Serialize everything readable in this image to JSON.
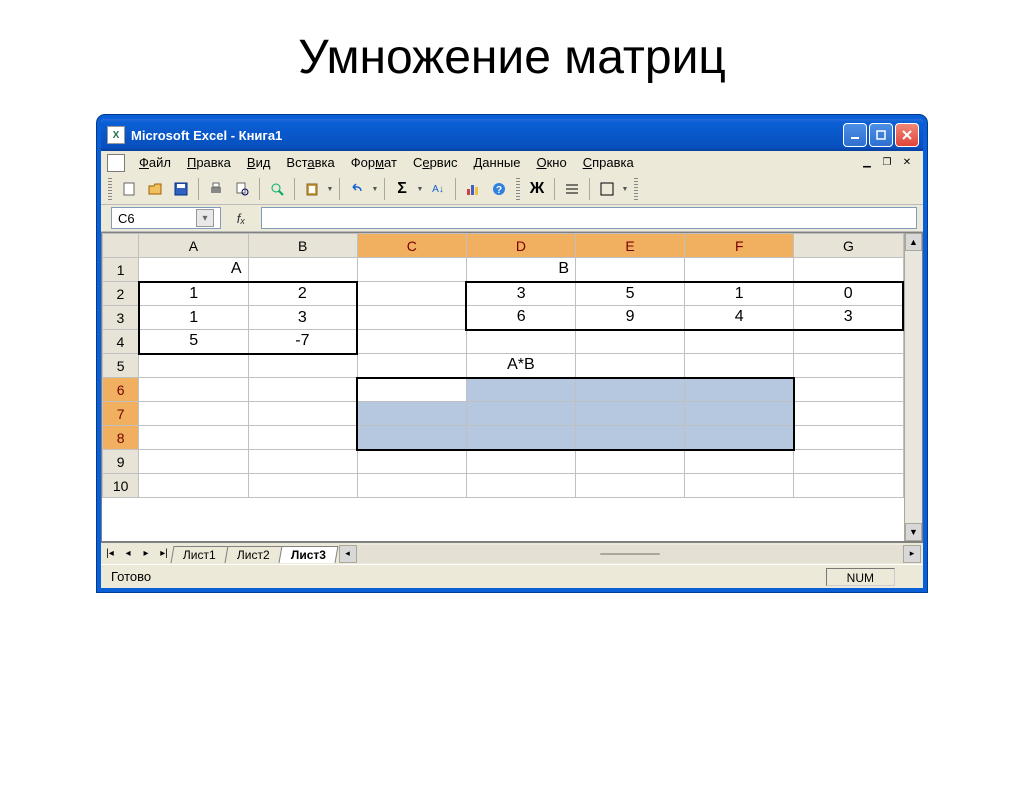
{
  "page_heading": "Умножение матриц",
  "window": {
    "title": "Microsoft Excel - Книга1"
  },
  "menus": [
    "Файл",
    "Правка",
    "Вид",
    "Вставка",
    "Формат",
    "Сервис",
    "Данные",
    "Окно",
    "Справка"
  ],
  "namebox": "C6",
  "columns": [
    "A",
    "B",
    "C",
    "D",
    "E",
    "F",
    "G"
  ],
  "selected_columns": [
    "C",
    "D",
    "E",
    "F"
  ],
  "selected_rows": [
    6,
    7,
    8
  ],
  "labels": {
    "matrixA": "A",
    "matrixB": "B",
    "result": "A*B"
  },
  "matrixA": [
    [
      1,
      2
    ],
    [
      1,
      3
    ],
    [
      5,
      -7
    ]
  ],
  "matrixB": [
    [
      3,
      5,
      1,
      0
    ],
    [
      6,
      9,
      4,
      3
    ]
  ],
  "sheets": [
    "Лист1",
    "Лист2",
    "Лист3"
  ],
  "active_sheet": "Лист3",
  "status": "Готово",
  "indicator": "NUM",
  "chart_data": {
    "type": "table",
    "title": "Умножение матриц",
    "matrices": {
      "A": {
        "rows": 3,
        "cols": 2,
        "data": [
          [
            1,
            2
          ],
          [
            1,
            3
          ],
          [
            5,
            -7
          ]
        ]
      },
      "B": {
        "rows": 2,
        "cols": 4,
        "data": [
          [
            3,
            5,
            1,
            0
          ],
          [
            6,
            9,
            4,
            3
          ]
        ]
      },
      "result_range": "C6:F8",
      "result_label": "A*B"
    }
  }
}
